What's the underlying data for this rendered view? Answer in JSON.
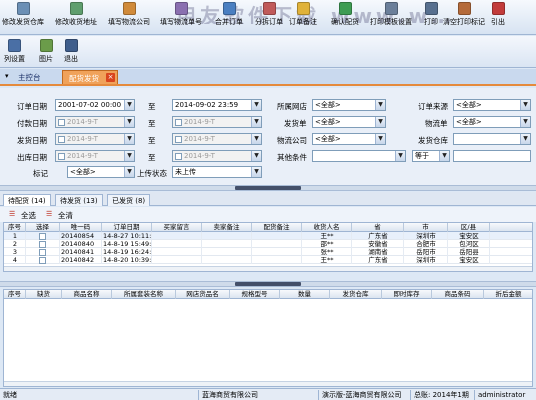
{
  "toolbar": {
    "items": [
      {
        "label": "修改发货仓库",
        "icon": "warehouse-icon",
        "color": "#6b8fb5"
      },
      {
        "label": "修改收货地址",
        "icon": "address-icon",
        "color": "#5f9e6e"
      },
      {
        "label": "填写物流公司",
        "icon": "truck-icon",
        "color": "#d08a3a"
      },
      {
        "label": "填写物流单号",
        "icon": "tracking-icon",
        "color": "#8a6fb0"
      },
      {
        "label": "合并订单",
        "icon": "merge-icon",
        "color": "#4a7fc1"
      },
      {
        "label": "分拆订单",
        "icon": "split-icon",
        "color": "#c05a5a"
      },
      {
        "label": "订单备注",
        "icon": "note-icon",
        "color": "#e0b23a"
      },
      {
        "label": "确认配货",
        "icon": "confirm-icon",
        "color": "#3e9c53"
      },
      {
        "label": "打印模板设置",
        "icon": "template-icon",
        "color": "#6b7f9a"
      },
      {
        "label": "打印",
        "icon": "printer-icon",
        "color": "#58708f"
      },
      {
        "label": "清空打印标记",
        "icon": "clear-icon",
        "color": "#b56b3b"
      },
      {
        "label": "引出",
        "icon": "export-icon",
        "color": "#c23b3b"
      }
    ],
    "watermark": "用友软件下载 www.w…"
  },
  "toolbar2": {
    "items": [
      {
        "label": "列设置",
        "icon": "columns-icon",
        "color": "#4a6fa5"
      },
      {
        "label": "图片",
        "icon": "image-icon",
        "color": "#6b9c4a"
      },
      {
        "label": "退出",
        "icon": "exit-icon",
        "color": "#3f5e8c"
      }
    ]
  },
  "tabs": {
    "main": "主控台",
    "active": "配货发货",
    "close": "×"
  },
  "filter": {
    "order_date_label": "订单日期",
    "order_date_from": "2001-07-02 00:00",
    "to1": "至",
    "order_date_to": "2014-09-02 23:59",
    "pay_date_label": "付款日期",
    "pay_date_from": "2014-9-T",
    "to2": "至",
    "pay_date_to": "2014-9-T",
    "ship_date_label": "发货日期",
    "ship_date_from": "2014-9-T",
    "to3": "至",
    "ship_date_to": "2014-9-T",
    "out_date_label": "出库日期",
    "out_date_from": "2014-9-T",
    "to4": "至",
    "out_date_to": "2014-9-T",
    "mark_label": "标记",
    "mark_value": "<全部>",
    "upload_label": "上传状态",
    "upload_value": "未上传",
    "shop_label": "所属网店",
    "shop_value": "<全部>",
    "shipper_label": "发货单",
    "shipper_value": "<全部>",
    "logistics_label": "物流公司",
    "logistics_value": "<全部>",
    "other_label": "其他条件",
    "other_value": "",
    "source_label": "订单来源",
    "source_value": "<全部>",
    "logistics_single_label": "物流单",
    "logistics_single_value": "<全部>",
    "warehouse_label": "发货仓库",
    "warehouse_value": "",
    "equal_value": "等于",
    "equal_input": ""
  },
  "subtabs": [
    "待配货 (14)",
    "待发货 (13)",
    "已发货 (8)"
  ],
  "actions": {
    "select_all": "全选",
    "clear_all": "全清"
  },
  "top_grid": {
    "headers": [
      "序号",
      "选择",
      "唯一码",
      "订单日期",
      "买家留言",
      "卖家备注",
      "配货备注",
      "收货人名",
      "省",
      "市",
      "区/县"
    ],
    "rows": [
      [
        "1",
        "",
        "20140854",
        "14-8-27 10:11:",
        "",
        "",
        "",
        "王**",
        "广东省",
        "深圳市",
        "宝安区"
      ],
      [
        "2",
        "",
        "20140840",
        "14-8-19 15:49:",
        "",
        "",
        "",
        "邵**",
        "安徽省",
        "合肥市",
        "包河区"
      ],
      [
        "3",
        "",
        "20140841",
        "14-8-19 16:24:",
        "",
        "",
        "",
        "张**",
        "湖南省",
        "岳阳市",
        "岳阳县"
      ],
      [
        "4",
        "",
        "20140842",
        "14-8-20 10:39:",
        "",
        "",
        "",
        "王**",
        "广东省",
        "深圳市",
        "宝安区"
      ]
    ]
  },
  "bottom_grid": {
    "headers": [
      "序号",
      "缺货",
      "商品名称",
      "所属套装名称",
      "网店货品名",
      "规格型号",
      "数量",
      "发货仓库",
      "即时库存",
      "商品条码",
      "折后金额"
    ]
  },
  "status": {
    "ready": "就绪",
    "company": "蓝海商贸有限公司",
    "version": "演示版-蓝海商贸有限公司",
    "total": "总账: 2014年1期",
    "user": "administrator"
  }
}
